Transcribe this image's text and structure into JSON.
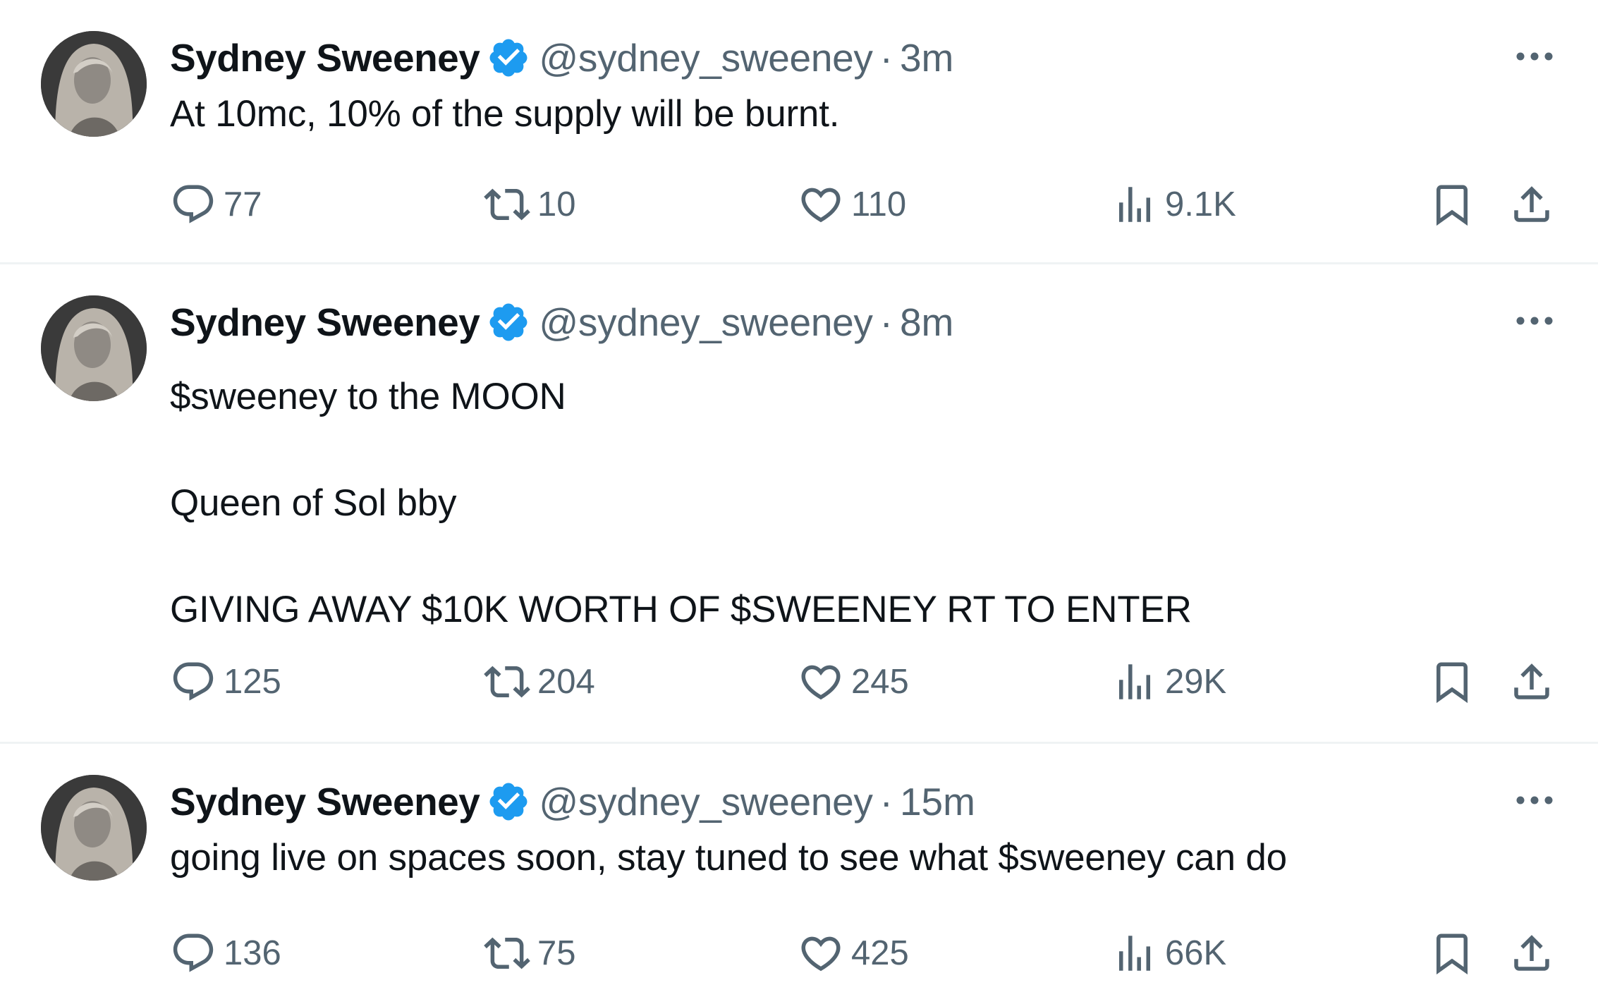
{
  "tweets": [
    {
      "name": "Sydney Sweeney",
      "handle": "@sydney_sweeney",
      "separator": "·",
      "time": "3m",
      "text": "At 10mc, 10% of the supply will be burnt.",
      "replies": "77",
      "retweets": "10",
      "likes": "110",
      "views": "9.1K"
    },
    {
      "name": "Sydney Sweeney",
      "handle": "@sydney_sweeney",
      "separator": "·",
      "time": "8m",
      "text": "$sweeney to the MOON\nQueen of Sol bby\nGIVING AWAY $10K WORTH OF $SWEENEY RT TO ENTER",
      "replies": "125",
      "retweets": "204",
      "likes": "245",
      "views": "29K"
    },
    {
      "name": "Sydney Sweeney",
      "handle": "@sydney_sweeney",
      "separator": "·",
      "time": "15m",
      "text": "going live on spaces soon, stay tuned to see what $sweeney can do",
      "replies": "136",
      "retweets": "75",
      "likes": "425",
      "views": "66K"
    }
  ],
  "icons": {
    "verified": "verified-badge-icon",
    "more": "more-options-icon",
    "reply": "reply-icon",
    "retweet": "retweet-icon",
    "like": "heart-icon",
    "views": "views-icon",
    "bookmark": "bookmark-icon",
    "share": "share-icon"
  },
  "colors": {
    "verified": "#1d9bf0",
    "text": "#0f1419",
    "muted": "#536471",
    "divider": "#eff3f4"
  }
}
